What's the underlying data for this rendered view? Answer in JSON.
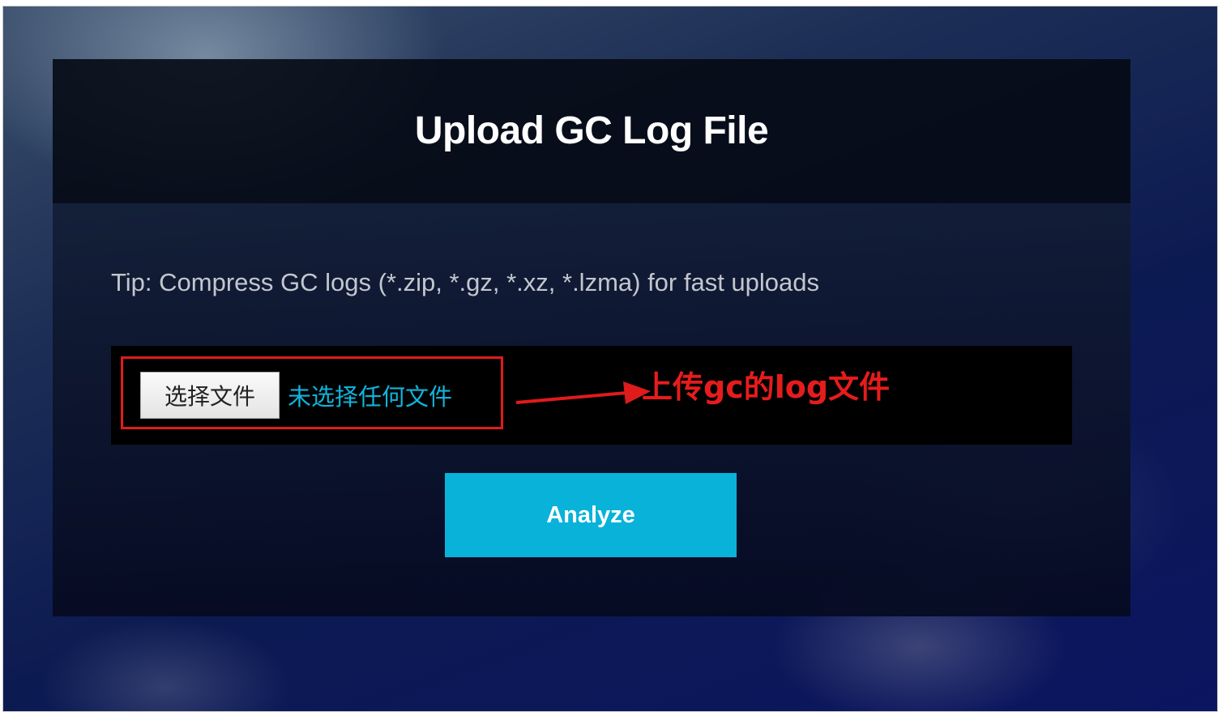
{
  "card": {
    "title": "Upload GC Log File"
  },
  "tip": "Tip: Compress GC logs (*.zip, *.gz, *.xz, *.lzma) for fast uploads",
  "file_input": {
    "button_label": "选择文件",
    "status_text": "未选择任何文件"
  },
  "annotation": {
    "text": "上传gc的log文件",
    "color": "#e61c1c"
  },
  "analyze_button": {
    "label": "Analyze",
    "color": "#08b2d9"
  }
}
